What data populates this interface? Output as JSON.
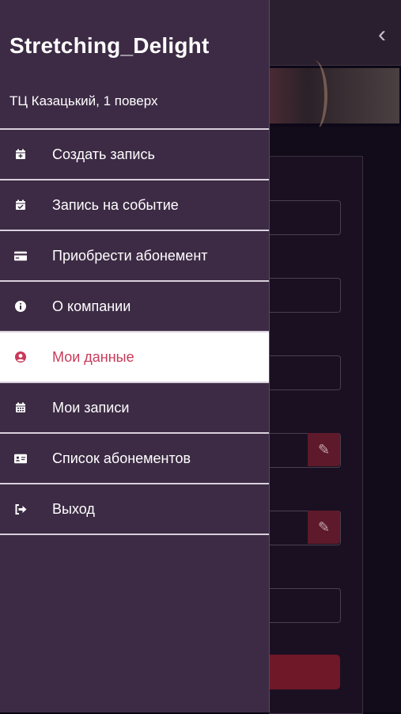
{
  "background": {
    "back_icon": "chevron-left-icon",
    "edit_icon": "pencil-icon"
  },
  "drawer": {
    "title": "Stretching_Delight",
    "subtitle": "ТЦ Казацький, 1 поверх",
    "items": [
      {
        "label": "Создать запись",
        "icon": "calendar-plus-icon",
        "active": false
      },
      {
        "label": "Запись на событие",
        "icon": "calendar-check-icon",
        "active": false
      },
      {
        "label": "Приобрести абонемент",
        "icon": "credit-card-icon",
        "active": false
      },
      {
        "label": "О компании",
        "icon": "info-circle-icon",
        "active": false
      },
      {
        "label": "Мои данные",
        "icon": "user-circle-icon",
        "active": true
      },
      {
        "label": "Мои записи",
        "icon": "calendar-icon",
        "active": false
      },
      {
        "label": "Список абонементов",
        "icon": "id-card-icon",
        "active": false
      },
      {
        "label": "Выход",
        "icon": "sign-out-icon",
        "active": false
      }
    ]
  },
  "colors": {
    "drawer_bg": "#3d2b45",
    "active_bg": "#ffffff",
    "active_text": "#c83a5a",
    "accent": "#6e1828"
  }
}
